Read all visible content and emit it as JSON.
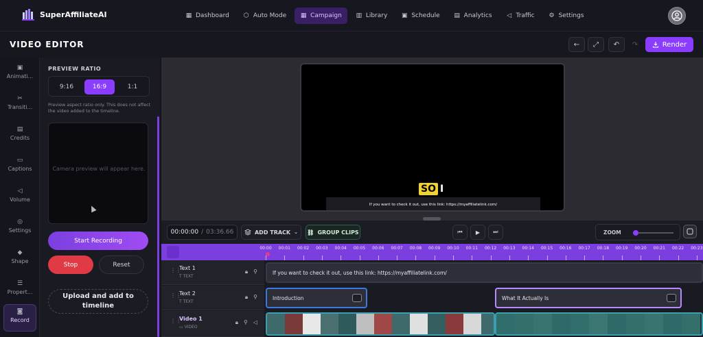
{
  "app": {
    "name": "SuperAffiliateAI"
  },
  "nav": [
    {
      "label": "Dashboard",
      "icon": "dashboard-icon",
      "glyph": "▦",
      "active": false
    },
    {
      "label": "Auto Mode",
      "icon": "cube-icon",
      "glyph": "⬡",
      "active": false
    },
    {
      "label": "Campaign",
      "icon": "grid-icon",
      "glyph": "▦",
      "active": true
    },
    {
      "label": "Library",
      "icon": "library-icon",
      "glyph": "▥",
      "active": false
    },
    {
      "label": "Schedule",
      "icon": "calendar-icon",
      "glyph": "▣",
      "active": false
    },
    {
      "label": "Analytics",
      "icon": "analytics-icon",
      "glyph": "▤",
      "active": false
    },
    {
      "label": "Traffic",
      "icon": "megaphone-icon",
      "glyph": "◁",
      "active": false
    },
    {
      "label": "Settings",
      "icon": "gear-icon",
      "glyph": "⚙",
      "active": false
    }
  ],
  "titlebar": {
    "title": "VIDEO EDITOR",
    "render_label": "Render"
  },
  "leftbar": [
    {
      "label": "Animati...",
      "icon": "animation-icon",
      "glyph": "▣"
    },
    {
      "label": "Transiti...",
      "icon": "scissors-icon",
      "glyph": "✂"
    },
    {
      "label": "Credits",
      "icon": "credits-icon",
      "glyph": "▤"
    },
    {
      "label": "Captions",
      "icon": "captions-icon",
      "glyph": "▭"
    },
    {
      "label": "Volume",
      "icon": "volume-icon",
      "glyph": "◁"
    },
    {
      "label": "Settings",
      "icon": "palette-icon",
      "glyph": "◎"
    },
    {
      "label": "Shape",
      "icon": "shape-icon",
      "glyph": "◆"
    },
    {
      "label": "Propert...",
      "icon": "properties-icon",
      "glyph": "☰"
    },
    {
      "label": "Record",
      "icon": "camera-icon",
      "glyph": "◙",
      "active": true
    }
  ],
  "record_panel": {
    "section_label": "PREVIEW RATIO",
    "ratios": [
      {
        "label": "9:16",
        "active": false
      },
      {
        "label": "16:9",
        "active": true
      },
      {
        "label": "1:1",
        "active": false
      }
    ],
    "note": "Preview aspect ratio only. This does not affect the video added to the timeline.",
    "camera_placeholder": "Camera preview will appear here.",
    "start_label": "Start Recording",
    "stop_label": "Stop",
    "reset_label": "Reset",
    "upload_label": "Upload and add to timeline"
  },
  "preview": {
    "highlight_word": "SO",
    "rest_word": "I",
    "subtitle": "If you want to check it out, use this link: https://myaffiliatelink.com/"
  },
  "controls": {
    "current_time": "00:00:00",
    "separator": "/",
    "total_time": "03:36.66",
    "add_track_label": "ADD TRACK",
    "group_clips_label": "GROUP CLIPS",
    "zoom_label": "ZOOM",
    "zoom_level": 0.05
  },
  "timeline": {
    "ticks": [
      "00:00",
      "00:01",
      "00:02",
      "00:03",
      "00:04",
      "00:05",
      "00:06",
      "00:07",
      "00:08",
      "00:09",
      "00:10",
      "00:11",
      "00:12",
      "00:13",
      "00:14",
      "00:15",
      "00:16",
      "00:17",
      "00:18",
      "00:19",
      "00:20",
      "00:21",
      "00:22",
      "00:23"
    ],
    "tracks": [
      {
        "name": "Text 1",
        "type": "TEXT"
      },
      {
        "name": "Text 2",
        "type": "TEXT"
      },
      {
        "name": "Video 1",
        "type": "VIDEO"
      }
    ],
    "clips": {
      "text1": "If you want to check it out, use this link: https://myaffiliatelink.com/",
      "text2a": "Introduction",
      "text2b": "What It Actually Is"
    }
  },
  "colors": {
    "accent": "#8b3dff",
    "stop": "#e03a45",
    "highlight": "#f2d230"
  }
}
